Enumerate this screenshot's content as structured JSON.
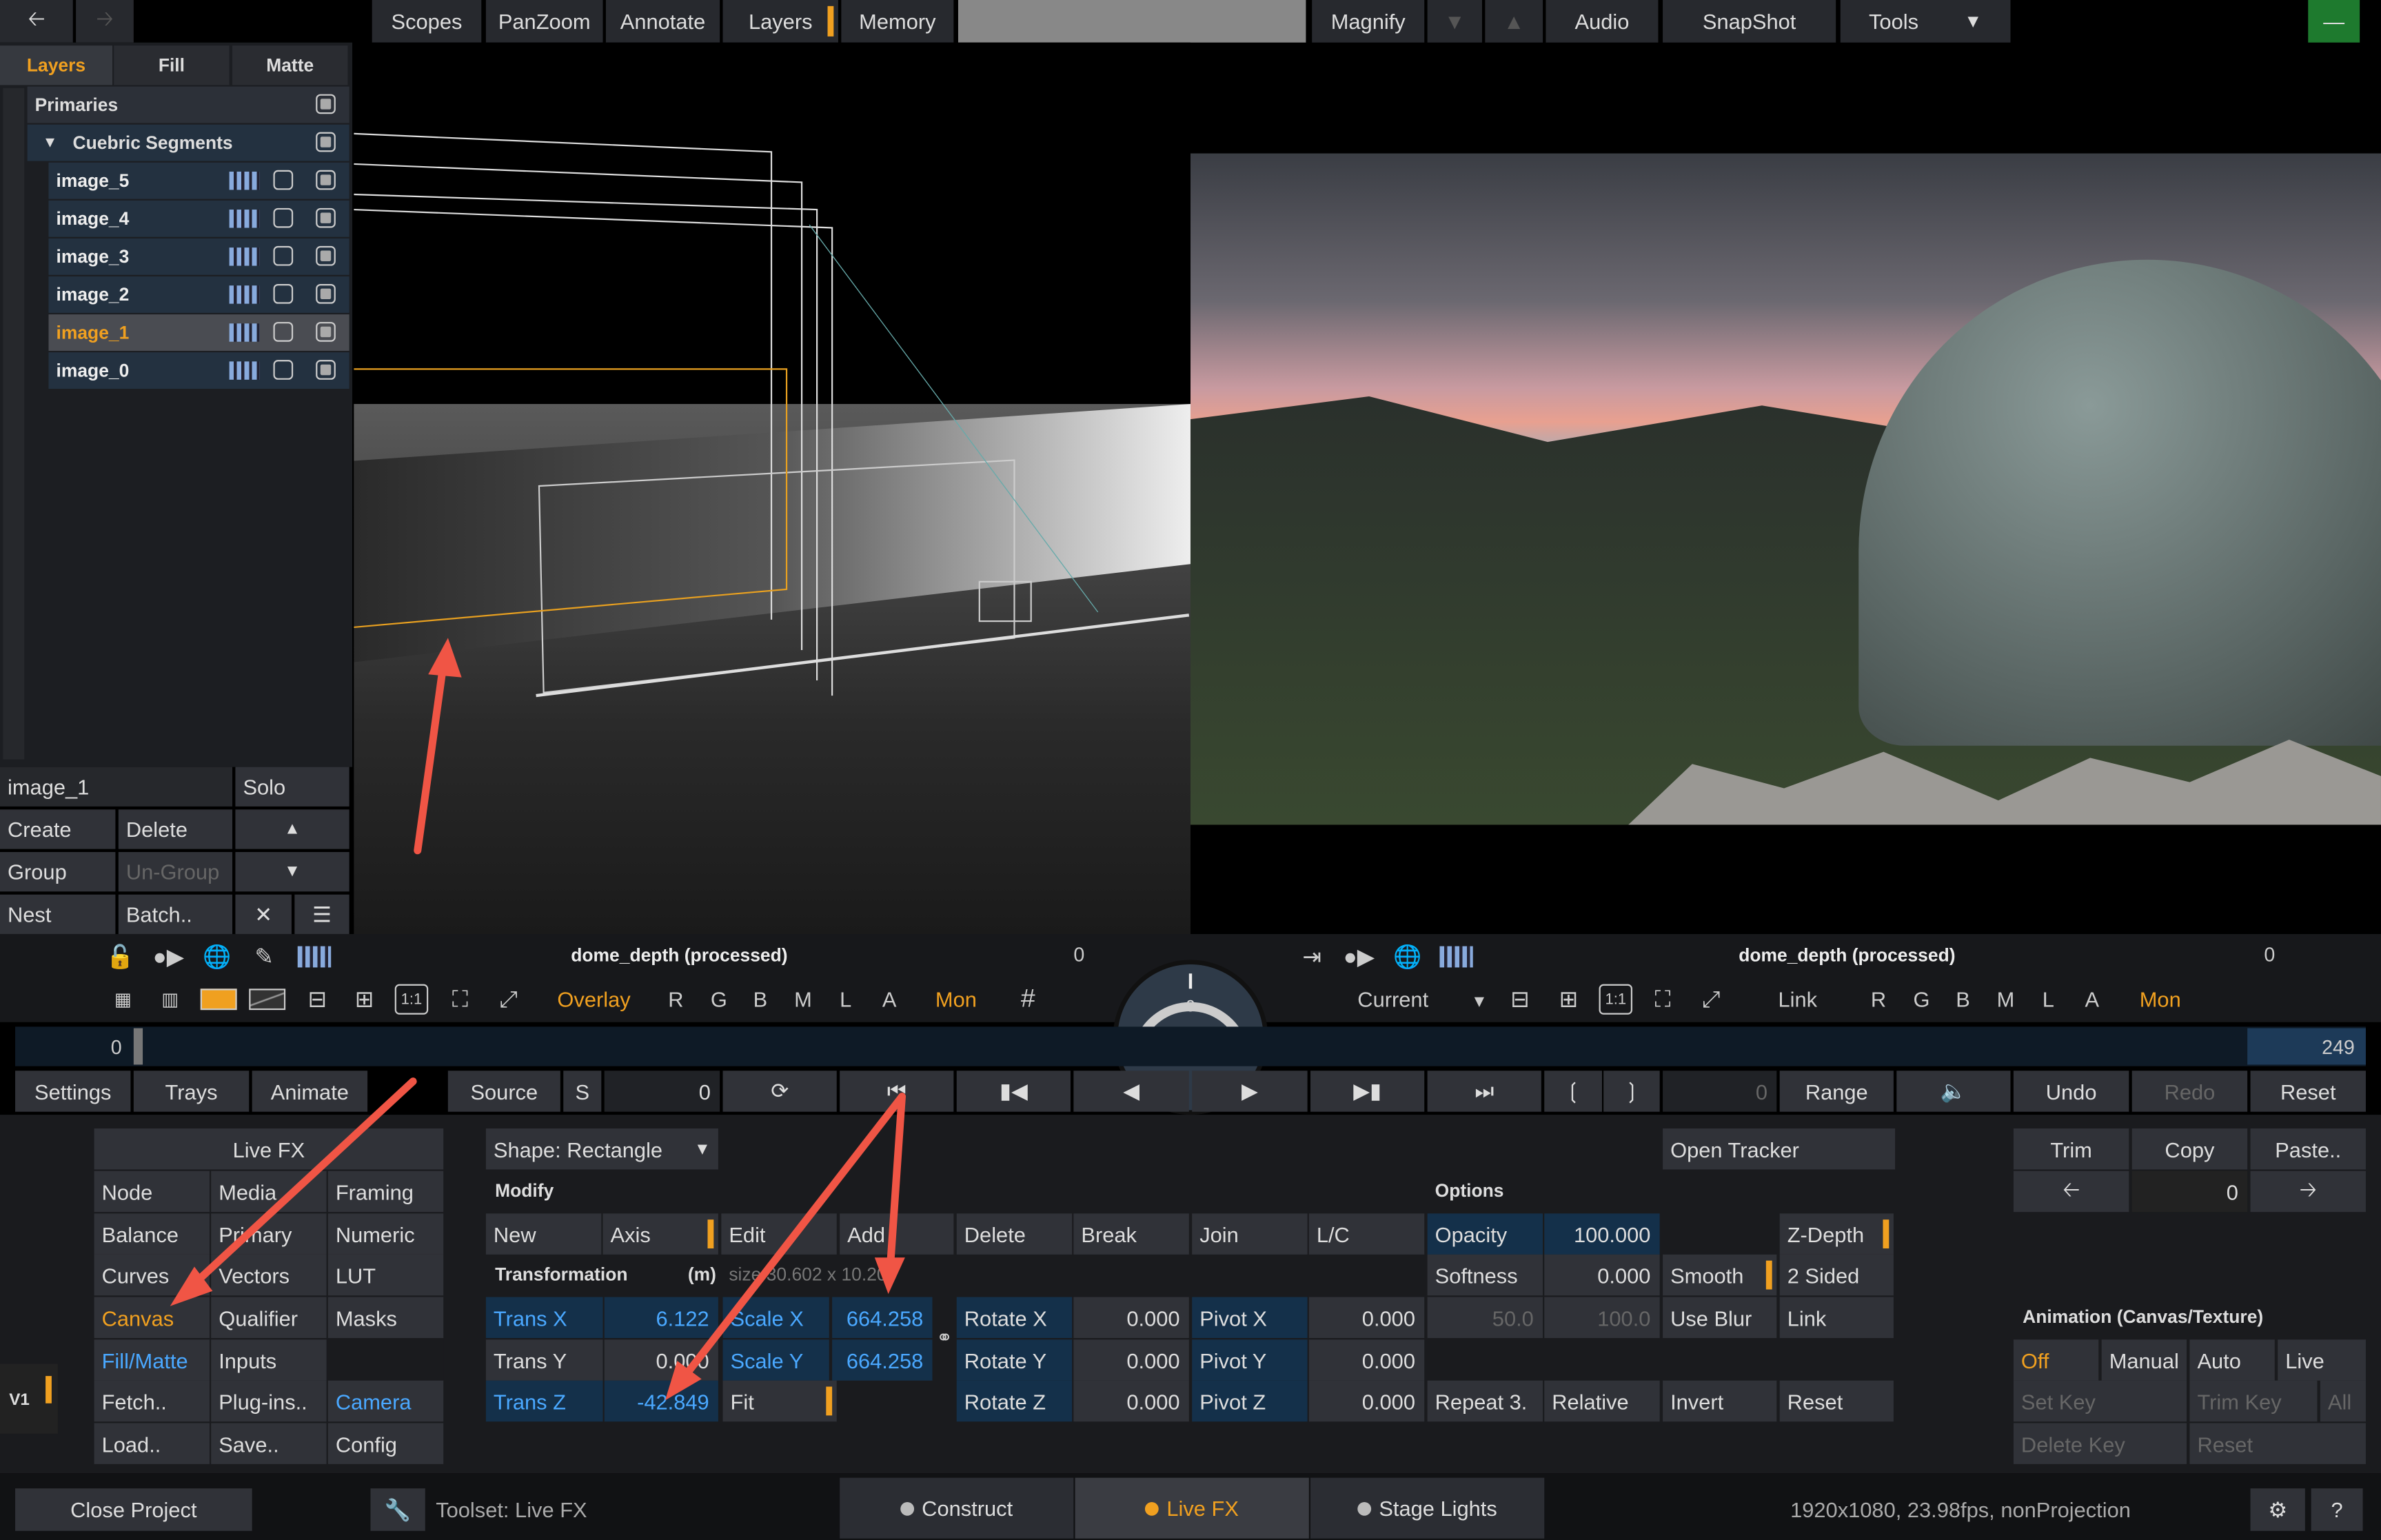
{
  "topbar": {
    "back_icon": "back-arrow-icon",
    "forward_icon": "forward-arrow-icon",
    "tabs": [
      "Scopes",
      "PanZoom",
      "Annotate",
      "Layers",
      "Memory"
    ],
    "magnify": "Magnify",
    "audio": "Audio",
    "snapshot": "SnapShot",
    "tools": "Tools"
  },
  "layers_panel": {
    "tabs": [
      "Layers",
      "Fill",
      "Matte"
    ],
    "primaries": "Primaries",
    "group": "Cuebric Segments",
    "items": [
      "image_5",
      "image_4",
      "image_3",
      "image_2",
      "image_1",
      "image_0"
    ],
    "selected_item": "image_1",
    "name_field": "image_1",
    "solo": "Solo",
    "create": "Create",
    "delete": "Delete",
    "group_btn": "Group",
    "ungroup": "Un-Group",
    "nest": "Nest",
    "batch": "Batch.."
  },
  "viewer_left": {
    "title": "dome_depth (processed)",
    "frame": "0",
    "overlay": "Overlay",
    "channels": [
      "R",
      "G",
      "B",
      "M",
      "L",
      "A"
    ],
    "mon": "Mon"
  },
  "viewer_right": {
    "title": "dome_depth (processed)",
    "frame": "0",
    "current": "Current",
    "link": "Link",
    "channels": [
      "R",
      "G",
      "B",
      "M",
      "L",
      "A"
    ],
    "mon": "Mon"
  },
  "dial": {
    "value": "0"
  },
  "timeline": {
    "start": "0",
    "end": "249"
  },
  "transport": {
    "settings": "Settings",
    "trays": "Trays",
    "animate": "Animate",
    "source": "Source",
    "s": "S",
    "frame": "0",
    "frame2": "0",
    "range": "Range",
    "undo": "Undo",
    "redo": "Redo",
    "reset": "Reset"
  },
  "livefx_menu": {
    "title": "Live FX",
    "col1": [
      "Node",
      "Balance",
      "Curves",
      "Canvas",
      "Fill/Matte",
      "Fetch..",
      "Load.."
    ],
    "col2": [
      "Media",
      "Primary",
      "Vectors",
      "Qualifier",
      "Inputs",
      "Plug-ins..",
      "Save.."
    ],
    "col3": [
      "Framing",
      "Numeric",
      "LUT",
      "Masks",
      "",
      "Camera",
      "Config"
    ]
  },
  "shape": {
    "dropdown": "Shape: Rectangle",
    "modify": "Modify",
    "new": "New",
    "axis": "Axis",
    "edit": "Edit",
    "add": "Add",
    "delete": "Delete",
    "break": "Break",
    "join": "Join",
    "lc": "L/C",
    "transformation": "Transformation",
    "units": "(m)",
    "size": "size 30.602 x 10.20",
    "open_tracker": "Open Tracker"
  },
  "transform": {
    "trans_x_label": "Trans X",
    "trans_x": "6.122",
    "trans_y_label": "Trans Y",
    "trans_y": "0.000",
    "trans_z_label": "Trans Z",
    "trans_z": "-42.849",
    "scale_x_label": "Scale X",
    "scale_x": "664.258",
    "scale_y_label": "Scale Y",
    "scale_y": "664.258",
    "fit": "Fit",
    "rotate_x_label": "Rotate X",
    "rotate_x": "0.000",
    "rotate_y_label": "Rotate Y",
    "rotate_y": "0.000",
    "rotate_z_label": "Rotate Z",
    "rotate_z": "0.000",
    "pivot_x_label": "Pivot X",
    "pivot_x": "0.000",
    "pivot_y_label": "Pivot Y",
    "pivot_y": "0.000",
    "pivot_z_label": "Pivot Z",
    "pivot_z": "0.000"
  },
  "options": {
    "title": "Options",
    "opacity_label": "Opacity",
    "opacity": "100.000",
    "softness_label": "Softness",
    "softness": "0.000",
    "smooth": "Smooth",
    "dim1": "50.0",
    "dim2": "100.0",
    "use_blur": "Use Blur",
    "z_depth": "Z-Depth",
    "two_sided": "2 Sided",
    "link": "Link",
    "repeat": "Repeat 3.",
    "relative": "Relative",
    "invert": "Invert",
    "reset": "Reset"
  },
  "right_panel": {
    "trim": "Trim",
    "copy": "Copy",
    "paste": "Paste..",
    "value": "0",
    "anim_title": "Animation (Canvas/Texture)",
    "off": "Off",
    "manual": "Manual",
    "auto": "Auto",
    "live": "Live",
    "set_key": "Set Key",
    "trim_key": "Trim Key",
    "all": "All",
    "delete_key": "Delete Key",
    "reset": "Reset"
  },
  "v1": "V1",
  "statusbar": {
    "close_project": "Close Project",
    "toolset": "Toolset: Live FX",
    "tabs": [
      "Construct",
      "Live FX",
      "Stage Lights"
    ],
    "info": "1920x1080, 23.98fps, nonProjection",
    "help": "?"
  },
  "colors": {
    "accent": "#f0a020",
    "blue": "#4aa8ff",
    "green": "#1e7a2e"
  }
}
